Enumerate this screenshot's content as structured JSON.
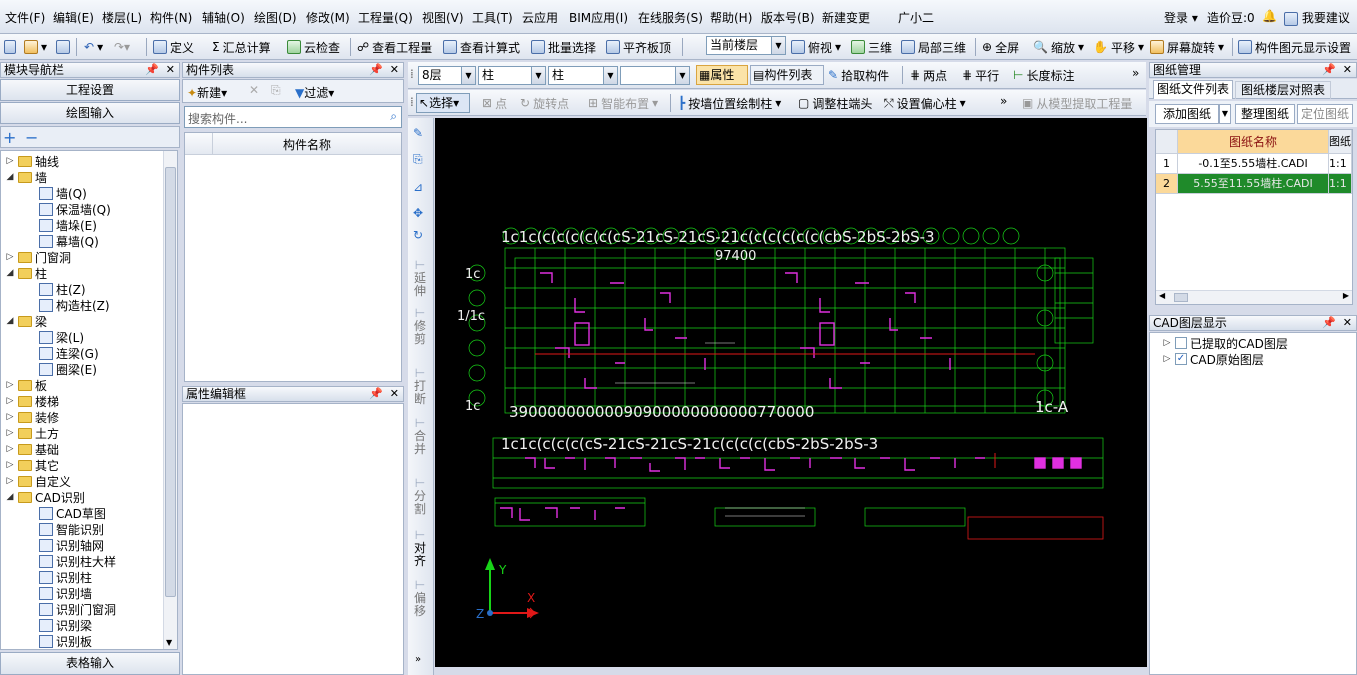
{
  "menu": [
    "文件(F)",
    "编辑(E)",
    "楼层(L)",
    "构件(N)",
    "辅轴(O)",
    "绘图(D)",
    "修改(M)",
    "工程量(Q)",
    "视图(V)",
    "工具(T)",
    "云应用",
    "BIM应用(I)",
    "在线服务(S)",
    "帮助(H)",
    "版本号(B)",
    "新建变更",
    "广小二"
  ],
  "menu_right": {
    "login": "登录",
    "price_bean": "造价豆:0",
    "suggest": "我要建议"
  },
  "toolbar": {
    "define": "定义",
    "sum_calc": "汇总计算",
    "cloud_check": "云检查",
    "view_qty": "查看工程量",
    "view_formula": "查看计算式",
    "batch_select": "批量选择",
    "align_top": "平齐板顶",
    "floor_combo": "当前楼层",
    "top_view": "俯视",
    "three_d": "三维",
    "local_3d": "局部三维",
    "fullscreen": "全屏",
    "zoom": "缩放",
    "pan": "平移",
    "rotate": "屏幕旋转",
    "display_settings": "构件图元显示设置"
  },
  "nav": {
    "title": "模块导航栏",
    "project_settings": "工程设置",
    "drawing_input": "绘图输入",
    "table_input": "表格输入",
    "tree": [
      {
        "label": "轴线",
        "level": 0,
        "type": "folder",
        "state": "closed"
      },
      {
        "label": "墙",
        "level": 0,
        "type": "folder",
        "state": "open"
      },
      {
        "label": "墙(Q)",
        "level": 1,
        "type": "leaf"
      },
      {
        "label": "保温墙(Q)",
        "level": 1,
        "type": "leaf"
      },
      {
        "label": "墙垛(E)",
        "level": 1,
        "type": "leaf"
      },
      {
        "label": "幕墙(Q)",
        "level": 1,
        "type": "leaf"
      },
      {
        "label": "门窗洞",
        "level": 0,
        "type": "folder",
        "state": "closed"
      },
      {
        "label": "柱",
        "level": 0,
        "type": "folder",
        "state": "open"
      },
      {
        "label": "柱(Z)",
        "level": 1,
        "type": "leaf"
      },
      {
        "label": "构造柱(Z)",
        "level": 1,
        "type": "leaf"
      },
      {
        "label": "梁",
        "level": 0,
        "type": "folder",
        "state": "open"
      },
      {
        "label": "梁(L)",
        "level": 1,
        "type": "leaf"
      },
      {
        "label": "连梁(G)",
        "level": 1,
        "type": "leaf"
      },
      {
        "label": "圈梁(E)",
        "level": 1,
        "type": "leaf"
      },
      {
        "label": "板",
        "level": 0,
        "type": "folder",
        "state": "closed"
      },
      {
        "label": "楼梯",
        "level": 0,
        "type": "folder",
        "state": "closed"
      },
      {
        "label": "装修",
        "level": 0,
        "type": "folder",
        "state": "closed"
      },
      {
        "label": "土方",
        "level": 0,
        "type": "folder",
        "state": "closed"
      },
      {
        "label": "基础",
        "level": 0,
        "type": "folder",
        "state": "closed"
      },
      {
        "label": "其它",
        "level": 0,
        "type": "folder",
        "state": "closed"
      },
      {
        "label": "自定义",
        "level": 0,
        "type": "folder",
        "state": "closed"
      },
      {
        "label": "CAD识别",
        "level": 0,
        "type": "folder",
        "state": "open"
      },
      {
        "label": "CAD草图",
        "level": 1,
        "type": "leaf"
      },
      {
        "label": "智能识别",
        "level": 1,
        "type": "leaf"
      },
      {
        "label": "识别轴网",
        "level": 1,
        "type": "leaf"
      },
      {
        "label": "识别柱大样",
        "level": 1,
        "type": "leaf"
      },
      {
        "label": "识别柱",
        "level": 1,
        "type": "leaf"
      },
      {
        "label": "识别墙",
        "level": 1,
        "type": "leaf"
      },
      {
        "label": "识别门窗洞",
        "level": 1,
        "type": "leaf"
      },
      {
        "label": "识别梁",
        "level": 1,
        "type": "leaf"
      },
      {
        "label": "识别板",
        "level": 1,
        "type": "leaf"
      }
    ]
  },
  "component_list": {
    "title": "构件列表",
    "new": "新建",
    "filter": "过滤",
    "search_placeholder": "搜索构件...",
    "col_name": "构件名称"
  },
  "property_editor": {
    "title": "属性编辑框"
  },
  "draw_toolbar": {
    "floor": "8层",
    "type1": "柱",
    "type2": "柱",
    "type3": "",
    "props": "属性",
    "comp_list": "构件列表",
    "pick": "拾取构件",
    "two_points": "两点",
    "parallel": "平行",
    "length_dim": "长度标注",
    "select": "选择",
    "point": "点",
    "rotate_point": "旋转点",
    "smart_place": "智能布置",
    "draw_by_wall": "按墙位置绘制柱",
    "adjust_col_end": "调整柱端头",
    "set_offset": "设置偏心柱",
    "extract_from_model": "从模型提取工程量"
  },
  "vertical_tools": [
    "延伸",
    "修剪",
    "打断",
    "合并",
    "分割",
    "对齐",
    "偏移"
  ],
  "drawing_mgr": {
    "title": "图纸管理",
    "tab1": "图纸文件列表",
    "tab2": "图纸楼层对照表",
    "add": "添加图纸",
    "organize": "整理图纸",
    "locate": "定位图纸",
    "col_name": "图纸名称",
    "col_ratio": "图纸",
    "rows": [
      {
        "index": "1",
        "name": "-0.1至5.55墙柱.CADI",
        "ratio": "1:1"
      },
      {
        "index": "2",
        "name": "5.55至11.55墙柱.CADI",
        "ratio": "1:1"
      }
    ]
  },
  "cad_layers": {
    "title": "CAD图层显示",
    "items": [
      {
        "label": "已提取的CAD图层",
        "checked": false
      },
      {
        "label": "CAD原始图层",
        "checked": true
      }
    ]
  },
  "canvas": {
    "axis_y": "Y",
    "axis_x": "X",
    "axis_z": "Z",
    "dim_top": "97400",
    "label_a": "1c-A"
  }
}
